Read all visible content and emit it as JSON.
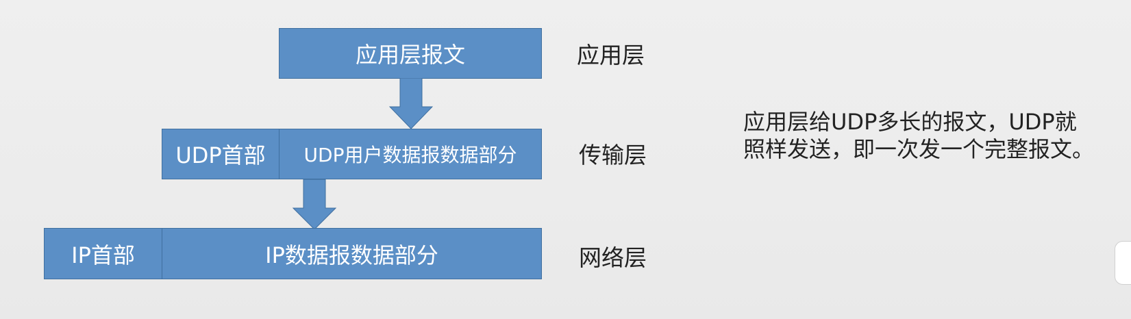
{
  "diagram": {
    "application_layer": {
      "message_label": "应用层报文",
      "layer_label": "应用层"
    },
    "transport_layer": {
      "header_label": "UDP首部",
      "data_label": "UDP用户数据报数据部分",
      "layer_label": "传输层"
    },
    "network_layer": {
      "header_label": "IP首部",
      "data_label": "IP数据报数据部分",
      "layer_label": "网络层"
    }
  },
  "note": {
    "line1": "应用层给UDP多长的报文，UDP就",
    "line2": "照样发送，即一次发一个完整报文。"
  }
}
